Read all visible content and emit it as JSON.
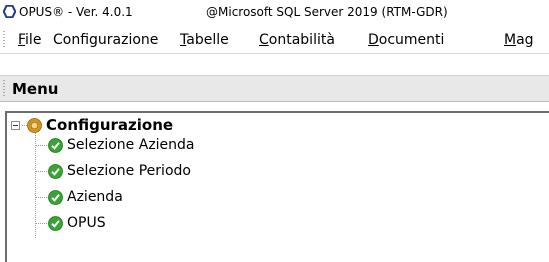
{
  "window": {
    "app_title": "OPUS® - Ver. 4.0.1",
    "server_info": "@Microsoft SQL Server 2019 (RTM-GDR)"
  },
  "menubar": {
    "items": [
      {
        "label": "File",
        "mnemonic": "F",
        "rest": "ile"
      },
      {
        "label": "Configurazione",
        "mnemonic": "",
        "rest": "Configurazione"
      },
      {
        "label": "Tabelle",
        "mnemonic": "T",
        "rest": "abelle"
      },
      {
        "label": "Contabilità",
        "mnemonic": "C",
        "rest": "ontabilità"
      },
      {
        "label": "Documenti",
        "mnemonic": "D",
        "rest": "ocumenti"
      },
      {
        "label": "Mag",
        "mnemonic": "M",
        "rest": "ag"
      }
    ]
  },
  "panel": {
    "title": "Menu"
  },
  "tree": {
    "root": {
      "label": "Configurazione",
      "icon": "gear-orange-icon",
      "expanded": true
    },
    "children": [
      {
        "label": "Selezione Azienda",
        "icon": "green-check-icon"
      },
      {
        "label": "Selezione Periodo",
        "icon": "green-check-icon"
      },
      {
        "label": "Azienda",
        "icon": "green-check-icon"
      },
      {
        "label": "OPUS",
        "icon": "green-check-icon"
      }
    ]
  },
  "colors": {
    "check_green": "#3aa335",
    "root_icon_orange": "#d4931e",
    "header_bg": "#e8e8e8"
  }
}
